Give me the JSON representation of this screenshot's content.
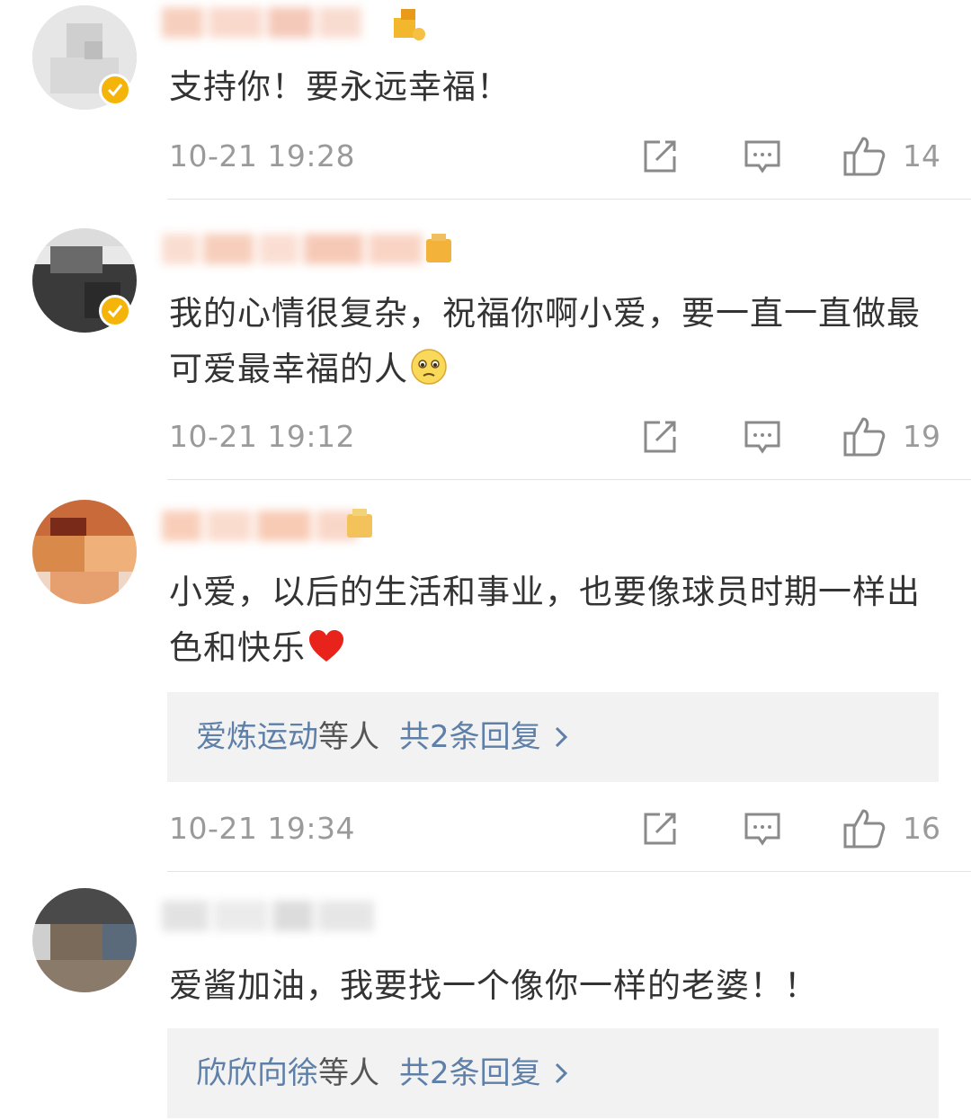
{
  "comments": [
    {
      "text": "支持你！要永远幸福！",
      "time": "10-21 19:28",
      "likes": "14",
      "verified": true
    },
    {
      "text": "我的心情很复杂，祝福你啊小爱，要一直一直做最可爱最幸福的人",
      "emoji": "pleading-face-emoji",
      "time": "10-21 19:12",
      "likes": "19",
      "verified": true
    },
    {
      "text": "小爱，以后的生活和事业，也要像球员时期一样出色和快乐",
      "emoji": "red-heart-emoji",
      "replies": {
        "names": "爱炼运动",
        "suffix": "等人",
        "count": "共2条回复"
      },
      "time": "10-21 19:34",
      "likes": "16",
      "verified": false
    },
    {
      "text": "爱酱加油，我要找一个像你一样的老婆！！",
      "replies": {
        "names": "欣欣向徐",
        "suffix": "等人",
        "count": "共2条回复"
      },
      "verified": false
    }
  ],
  "icons": {
    "share": "share-icon",
    "comment": "comment-icon",
    "like": "thumbs-up-icon",
    "chevron": "chevron-right-icon"
  },
  "colors": {
    "verified_badge": "#f5b40a",
    "reply_link": "#5d7fa8",
    "meta_text": "#9a9a9a"
  }
}
